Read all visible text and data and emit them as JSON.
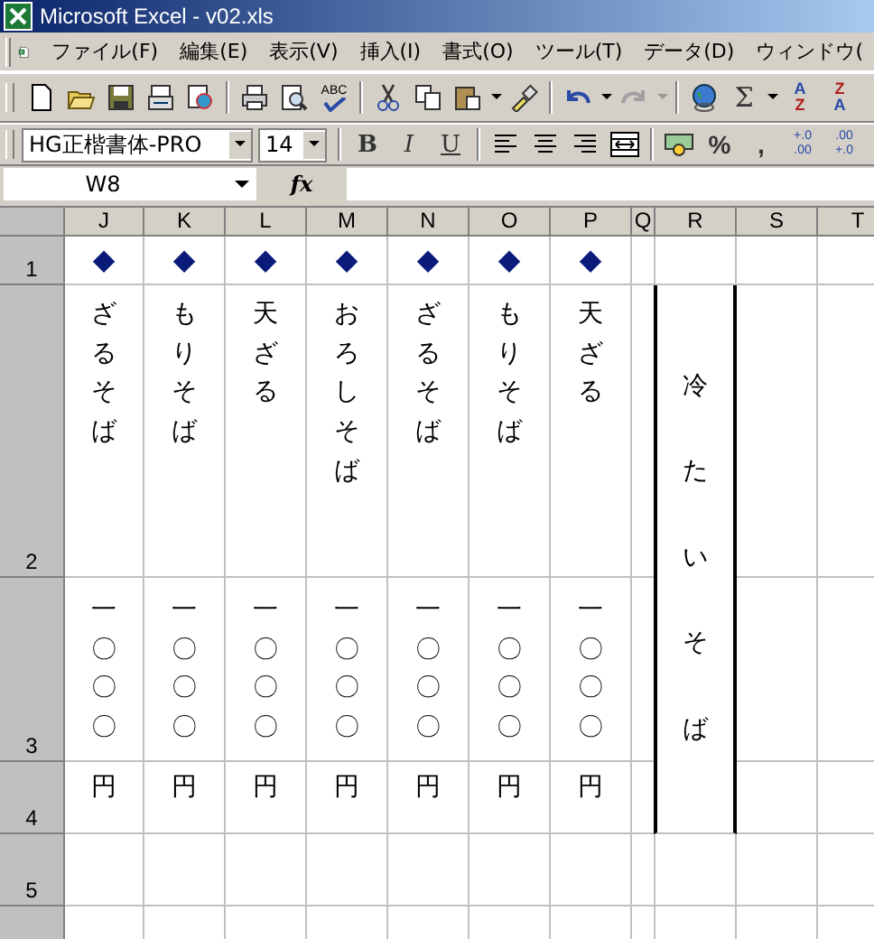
{
  "window": {
    "title": "Microsoft Excel - v02.xls"
  },
  "menu": [
    "ファイル(F)",
    "編集(E)",
    "表示(V)",
    "挿入(I)",
    "書式(O)",
    "ツール(T)",
    "データ(D)",
    "ウィンドウ("
  ],
  "toolbar": {
    "spelling_label": "ABC",
    "undo": {
      "disabled": false
    },
    "redo": {
      "disabled": true
    },
    "autosum": "Σ",
    "sort_ascending": [
      "A",
      "Z"
    ],
    "sort_descending": [
      "Z",
      "A"
    ]
  },
  "format_bar": {
    "font": "HG正楷書体-PRO",
    "size": "14",
    "bold": "B",
    "italic": "I",
    "underline": "U",
    "percent": "%",
    "comma": ",",
    "increase_decimal": [
      "+.0",
      ".00"
    ],
    "decrease_decimal": [
      ".00",
      "+.0"
    ]
  },
  "formula_bar": {
    "name_box": "W8",
    "fx": "fx"
  },
  "sheet": {
    "columns": [
      "J",
      "K",
      "L",
      "M",
      "N",
      "O",
      "P",
      "Q",
      "R",
      "S",
      "T"
    ],
    "rows": [
      {
        "header": "1",
        "cells": [
          "◆",
          "◆",
          "◆",
          "◆",
          "◆",
          "◆",
          "◆"
        ]
      },
      {
        "header": "2",
        "cells": [
          "ざるそば",
          "もりそば",
          "天ざる",
          "おろしそば",
          "ざるそば",
          "もりそば",
          "天ざる"
        ]
      },
      {
        "header": "3",
        "cells": [
          "一〇〇〇",
          "一〇〇〇",
          "一〇〇〇",
          "一〇〇〇",
          "一〇〇〇",
          "一〇〇〇",
          "一〇〇〇"
        ]
      },
      {
        "header": "4",
        "cells": [
          "円",
          "円",
          "円",
          "円",
          "円",
          "円",
          "円"
        ]
      },
      {
        "header": "5"
      }
    ],
    "merged_cell": {
      "text": "冷たいそば"
    }
  }
}
